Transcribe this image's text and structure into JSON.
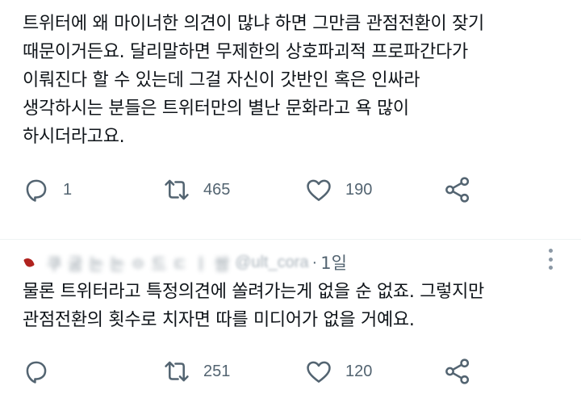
{
  "tweet1": {
    "text": "트위터에 왜 마이너한 의견이 많냐 하면 그만큼 관점전환이 잦기\n때문이거든요. 달리말하면 무제한의 상호파괴적 프로파간다가\n이뤄진다 할 수 있는데 그걸 자신이 갓반인 혹은 인싸라\n생각하시는 분들은 트위터만의 별난 문화라고 욕 많이\n하시더라고요.",
    "replies": "1",
    "retweets": "465",
    "likes": "190"
  },
  "tweet2": {
    "author_name": "쿠 굼 는 는 ㅇ 드 ㄷ ㅣ 쌈",
    "handle": "@ult_cora",
    "separator": "·",
    "timestamp": "1일",
    "text": "물론 트위터라고 특정의견에 쏠려가는게 없을 순 없죠. 그렇지만\n관점전환의 횟수로 치자면 따를 미디어가 없을 거예요.",
    "replies": "",
    "retweets": "251",
    "likes": "120"
  },
  "icons": {
    "reply": "reply-icon",
    "retweet": "retweet-icon",
    "like": "heart-icon",
    "share": "share-icon",
    "more": "more-options-icon"
  },
  "colors": {
    "text": "#0f1419",
    "secondary": "#536471",
    "divider": "#eff3f4"
  }
}
